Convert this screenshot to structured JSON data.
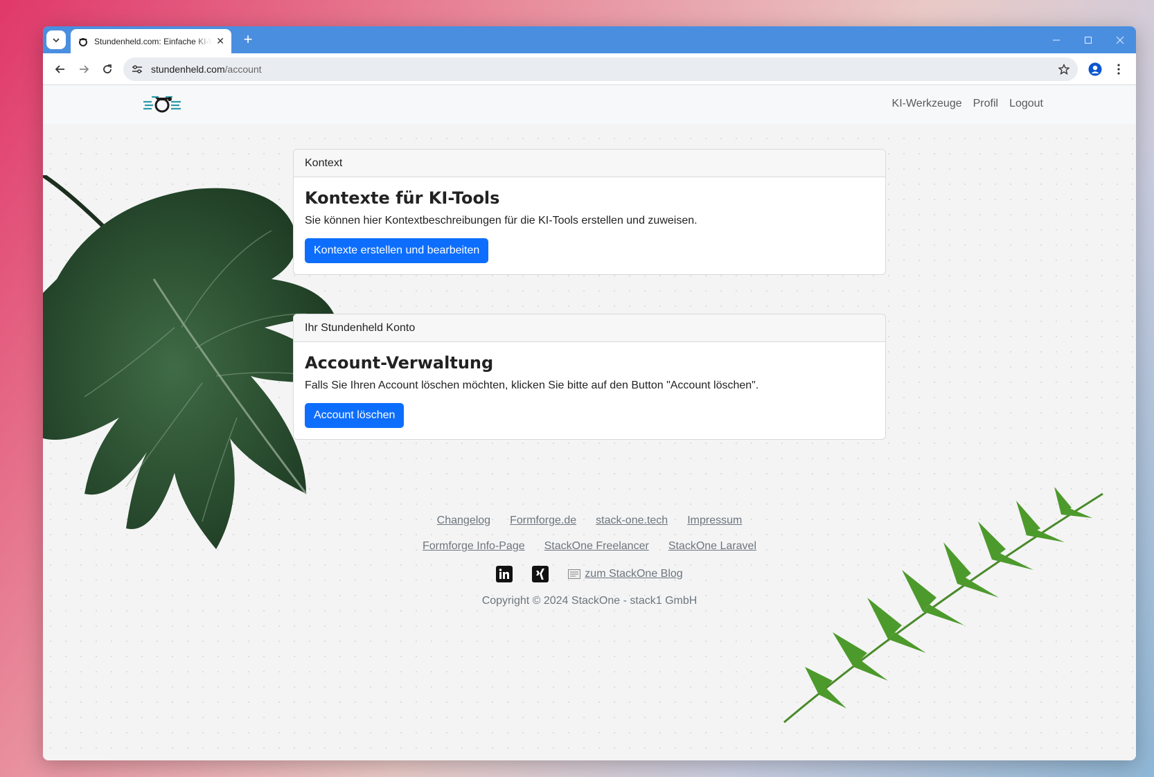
{
  "browser": {
    "tab_title": "Stundenheld.com: Einfache KI-Werkzeuge",
    "url_host": "stundenheld.com",
    "url_path": "/account"
  },
  "nav": {
    "links": [
      "KI-Werkzeuge",
      "Profil",
      "Logout"
    ]
  },
  "cards": [
    {
      "header": "Kontext",
      "title": "Kontexte für KI-Tools",
      "text": "Sie können hier Kontextbeschreibungen für die KI-Tools erstellen und zuweisen.",
      "button": "Kontexte erstellen und bearbeiten"
    },
    {
      "header": "Ihr Stundenheld Konto",
      "title": "Account-Verwaltung",
      "text": "Falls Sie Ihren Account löschen möchten, klicken Sie bitte auf den Button \"Account löschen\".",
      "button": "Account löschen"
    }
  ],
  "footer": {
    "row1": [
      "Changelog",
      "Formforge.de",
      "stack-one.tech",
      "Impressum"
    ],
    "row2": [
      "Formforge Info-Page",
      "StackOne Freelancer",
      "StackOne Laravel"
    ],
    "blog_link": "zum StackOne Blog",
    "copyright": "Copyright © 2024 StackOne - stack1 GmbH"
  },
  "colors": {
    "primary": "#0d6efd",
    "tabstrip": "#4a8ee0"
  }
}
